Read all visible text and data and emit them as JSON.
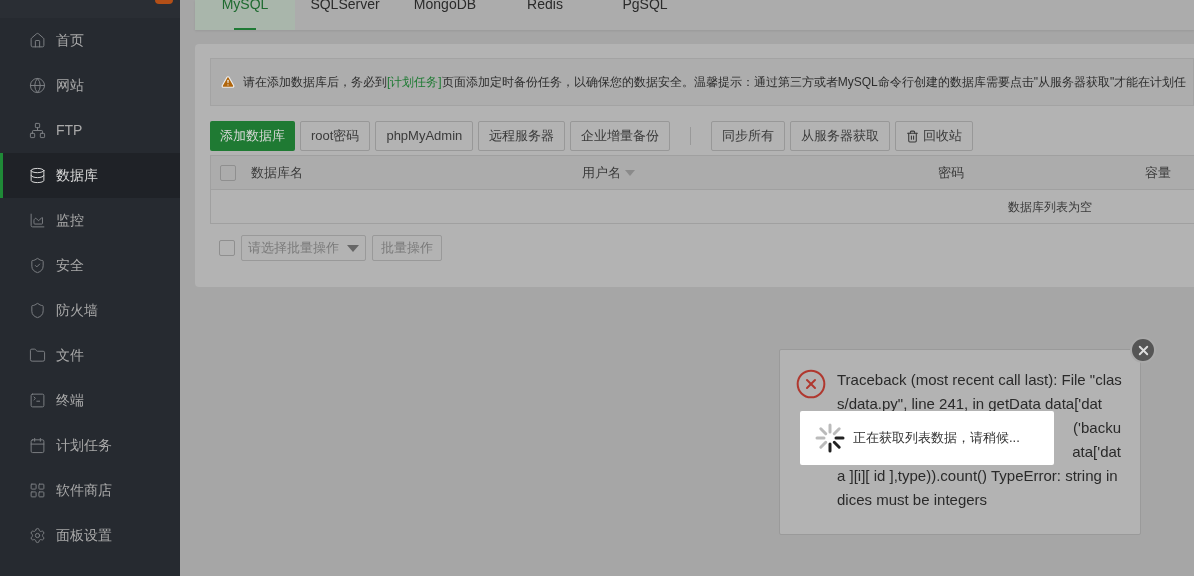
{
  "sidebar": {
    "items": [
      {
        "label": "首页",
        "selected": false
      },
      {
        "label": "网站",
        "selected": false
      },
      {
        "label": "FTP",
        "selected": false
      },
      {
        "label": "数据库",
        "selected": true
      },
      {
        "label": "监控",
        "selected": false
      },
      {
        "label": "安全",
        "selected": false
      },
      {
        "label": "防火墙",
        "selected": false
      },
      {
        "label": "文件",
        "selected": false
      },
      {
        "label": "终端",
        "selected": false
      },
      {
        "label": "计划任务",
        "selected": false
      },
      {
        "label": "软件商店",
        "selected": false
      },
      {
        "label": "面板设置",
        "selected": false
      }
    ]
  },
  "tabs": [
    {
      "label": "MySQL",
      "selected": true
    },
    {
      "label": "SQLServer",
      "selected": false
    },
    {
      "label": "MongoDB",
      "selected": false
    },
    {
      "label": "Redis",
      "selected": false
    },
    {
      "label": "PgSQL",
      "selected": false
    }
  ],
  "notice": {
    "before": "请在添加数据库后，务必到",
    "link": "[计划任务]",
    "after": "页面添加定时备份任务，以确保您的数据安全。温馨提示：通过第三方或者MySQL命令行创建的数据库需要点击\"从服务器获取\"才能在计划任"
  },
  "toolbar": {
    "primary": "添加数据库",
    "group1": [
      "root密码",
      "phpMyAdmin",
      "远程服务器",
      "企业增量备份"
    ],
    "group2": [
      "同步所有",
      "从服务器获取"
    ],
    "recycle": "回收站"
  },
  "table": {
    "select_all_checked": false,
    "columns": [
      "数据库名",
      "用户名",
      "密码",
      "容量"
    ],
    "empty": "数据库列表为空"
  },
  "batch": {
    "checked": false,
    "placeholder": "请选择批量操作",
    "button": "批量操作"
  },
  "error_dialog": {
    "lines": [
      "Traceback (most recent call last): File \"clas",
      "s/data.py\", line 241, in getData data['dat",
      "('backu",
      "ata['dat",
      "a ][i][ id ],type)).count() TypeError: string in",
      "dices must be integers"
    ]
  },
  "loading": {
    "text": "正在获取列表数据，请稍候..."
  }
}
